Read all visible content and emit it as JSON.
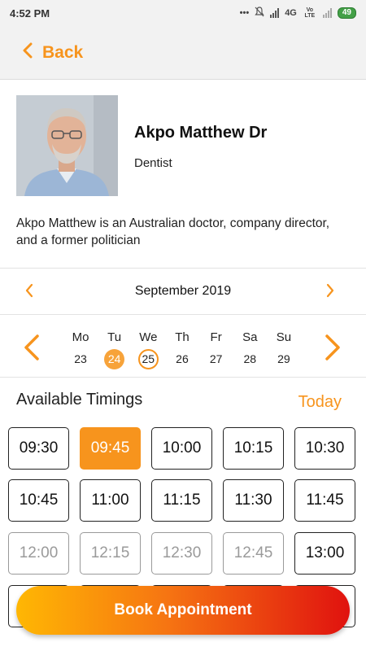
{
  "status_bar": {
    "time": "4:52 PM",
    "dots": "•••",
    "network": "4G",
    "network_sub": "Vo LTE",
    "battery": "49"
  },
  "header": {
    "back_label": "Back",
    "back_icon": "chevron-left-icon",
    "accent_color": "#f7941d"
  },
  "doctor": {
    "name": "Akpo Matthew Dr",
    "role": "Dentist",
    "bio": "Akpo Matthew is an Australian doctor, company director, and a former politician"
  },
  "calendar": {
    "month": "September 2019",
    "days": [
      {
        "name": "Mo",
        "num": "23",
        "state": "normal"
      },
      {
        "name": "Tu",
        "num": "24",
        "state": "selected"
      },
      {
        "name": "We",
        "num": "25",
        "state": "today"
      },
      {
        "name": "Th",
        "num": "26",
        "state": "normal"
      },
      {
        "name": "Fr",
        "num": "27",
        "state": "normal"
      },
      {
        "name": "Sa",
        "num": "28",
        "state": "normal"
      },
      {
        "name": "Su",
        "num": "29",
        "state": "normal"
      }
    ]
  },
  "timings": {
    "title": "Available Timings",
    "today_label": "Today",
    "slots": [
      {
        "time": "09:30",
        "state": "available"
      },
      {
        "time": "09:45",
        "state": "selected"
      },
      {
        "time": "10:00",
        "state": "available"
      },
      {
        "time": "10:15",
        "state": "available"
      },
      {
        "time": "10:30",
        "state": "available"
      },
      {
        "time": "10:45",
        "state": "available"
      },
      {
        "time": "11:00",
        "state": "available"
      },
      {
        "time": "11:15",
        "state": "available"
      },
      {
        "time": "11:30",
        "state": "available"
      },
      {
        "time": "11:45",
        "state": "available"
      },
      {
        "time": "12:00",
        "state": "disabled"
      },
      {
        "time": "12:15",
        "state": "disabled"
      },
      {
        "time": "12:30",
        "state": "disabled"
      },
      {
        "time": "12:45",
        "state": "disabled"
      },
      {
        "time": "13:00",
        "state": "available"
      },
      {
        "time": "",
        "state": "available"
      },
      {
        "time": "",
        "state": "available"
      },
      {
        "time": "",
        "state": "available"
      },
      {
        "time": "",
        "state": "available"
      },
      {
        "time": "",
        "state": "available"
      }
    ]
  },
  "book_button": {
    "label": "Book Appointment"
  }
}
